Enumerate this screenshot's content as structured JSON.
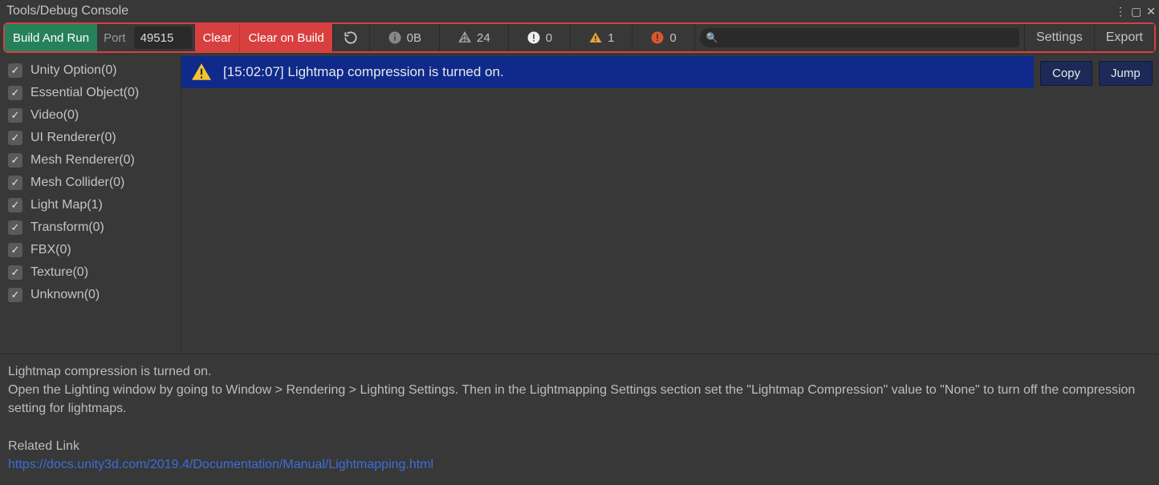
{
  "window": {
    "title": "Tools/Debug Console"
  },
  "toolbar": {
    "build_run": "Build And Run",
    "port_label": "Port",
    "port_value": "49515",
    "clear": "Clear",
    "clear_on_build": "Clear on Build",
    "stats": {
      "bytes": "0B",
      "tri": "24",
      "info_bang": "0",
      "warn": "1",
      "error": "0"
    },
    "search_placeholder": "",
    "settings": "Settings",
    "export": "Export"
  },
  "sidebar": {
    "items": [
      {
        "label": "Unity Option(0)",
        "checked": true
      },
      {
        "label": "Essential Object(0)",
        "checked": true
      },
      {
        "label": "Video(0)",
        "checked": true
      },
      {
        "label": "UI Renderer(0)",
        "checked": true
      },
      {
        "label": "Mesh Renderer(0)",
        "checked": true
      },
      {
        "label": "Mesh Collider(0)",
        "checked": true
      },
      {
        "label": "Light Map(1)",
        "checked": true
      },
      {
        "label": "Transform(0)",
        "checked": true
      },
      {
        "label": "FBX(0)",
        "checked": true
      },
      {
        "label": "Texture(0)",
        "checked": true
      },
      {
        "label": "Unknown(0)",
        "checked": true
      }
    ]
  },
  "log": {
    "time": "[15:02:07]",
    "message": "Lightmap compression is turned on.",
    "copy": "Copy",
    "jump": "Jump"
  },
  "details": {
    "line1": "Lightmap compression is turned on.",
    "line2": "Open the Lighting window by going to Window > Rendering > Lighting Settings. Then in the Lightmapping Settings section set the \"Lightmap Compression\" value to \"None\" to turn off the compression setting for lightmaps.",
    "related_heading": "Related Link",
    "link": "https://docs.unity3d.com/2019.4/Documentation/Manual/Lightmapping.html"
  }
}
